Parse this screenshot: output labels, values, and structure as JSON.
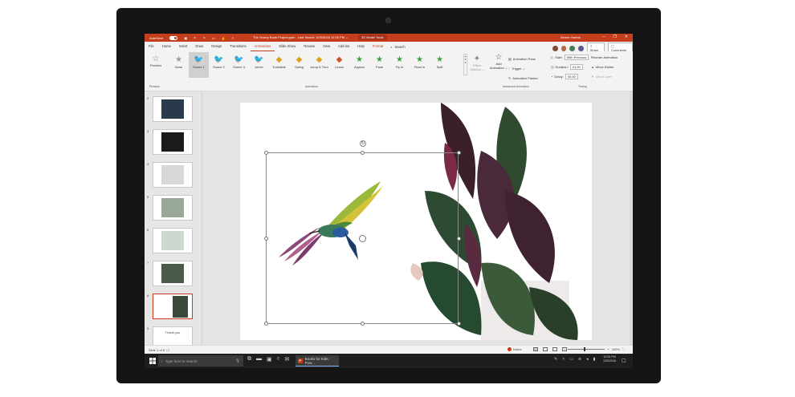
{
  "titlebar": {
    "autosave_label": "AutoSave",
    "document_title": "The Ocarty Book Project.pptx  -  Last Saved: 12/5/2018  12:00 PM  ⌄",
    "contextual_tools": "3D Model Tools",
    "user": "Aimee Owens",
    "minimize": "–",
    "restore": "❐",
    "close": "✕"
  },
  "tabs": [
    "File",
    "Home",
    "Insert",
    "Draw",
    "Design",
    "Transitions",
    "Animations",
    "Slide Show",
    "Review",
    "View",
    "Add-ins",
    "Help",
    "Format"
  ],
  "active_tab": "Animations",
  "search_label": "Search",
  "share_label": "Share",
  "comments_label": "Comments",
  "ribbon": {
    "preview_label": "Preview",
    "animations": [
      {
        "label": "None",
        "glyph": "★",
        "color": "#9a9a9a"
      },
      {
        "label": "Scene 1",
        "glyph": "🐦",
        "color": "#555555"
      },
      {
        "label": "Scene 2",
        "glyph": "🐦",
        "color": "#555555"
      },
      {
        "label": "Scene 3",
        "glyph": "🐦",
        "color": "#555555"
      },
      {
        "label": "Arrive",
        "glyph": "🐦",
        "color": "#555555"
      },
      {
        "label": "Turntable",
        "glyph": "◆",
        "color": "#e0a020"
      },
      {
        "label": "Swing",
        "glyph": "◆",
        "color": "#e0a020"
      },
      {
        "label": "Jump & Turn",
        "glyph": "◆",
        "color": "#e0a020"
      },
      {
        "label": "Leave",
        "glyph": "◆",
        "color": "#d0502a"
      },
      {
        "label": "Appear",
        "glyph": "★",
        "color": "#3aa040"
      },
      {
        "label": "Fade",
        "glyph": "★",
        "color": "#3aa040"
      },
      {
        "label": "Fly In",
        "glyph": "★",
        "color": "#3aa040"
      },
      {
        "label": "Float In",
        "glyph": "★",
        "color": "#3aa040"
      },
      {
        "label": "Split",
        "glyph": "★",
        "color": "#3aa040"
      }
    ],
    "selected_animation": "Scene 1",
    "effect_options": "Effect Options ⌄",
    "add_animation": "Add Animation ⌄",
    "animation_pane": "Animation Pane",
    "trigger": "Trigger ⌄",
    "animation_painter": "Animation Painter",
    "start_label": "Start:",
    "start_value": "With Previous",
    "duration_label": "Duration:",
    "duration_value": "01.00",
    "delay_label": "Delay:",
    "delay_value": "00.00",
    "reorder_label": "Reorder Animation",
    "move_earlier": "Move Earlier",
    "move_later": "Move Later",
    "groups": {
      "preview": "Preview",
      "animation": "Animation",
      "advanced": "Advanced Animation",
      "timing": "Timing"
    }
  },
  "thumbnails": [
    {
      "num": "2",
      "sel": false
    },
    {
      "num": "3",
      "sel": false
    },
    {
      "num": "4",
      "sel": false
    },
    {
      "num": "5",
      "sel": false
    },
    {
      "num": "6",
      "sel": false
    },
    {
      "num": "7",
      "sel": false
    },
    {
      "num": "8",
      "sel": true
    },
    {
      "num": "9",
      "sel": false
    }
  ],
  "partial_thumb_text": "Thank you",
  "statusbar": {
    "slide_info": "Slide 1 of 8",
    "notes": "Notes",
    "zoom": "100%",
    "zoom_minus": "−",
    "zoom_plus": "+"
  },
  "taskbar": {
    "search_placeholder": "Type here to search",
    "app_label": "Books for Kids - Pow...",
    "time": "12:00 PM",
    "date": "12/5/2018"
  },
  "colors": {
    "accent": "#c43e1c",
    "taskbar": "#1e1e1e"
  }
}
